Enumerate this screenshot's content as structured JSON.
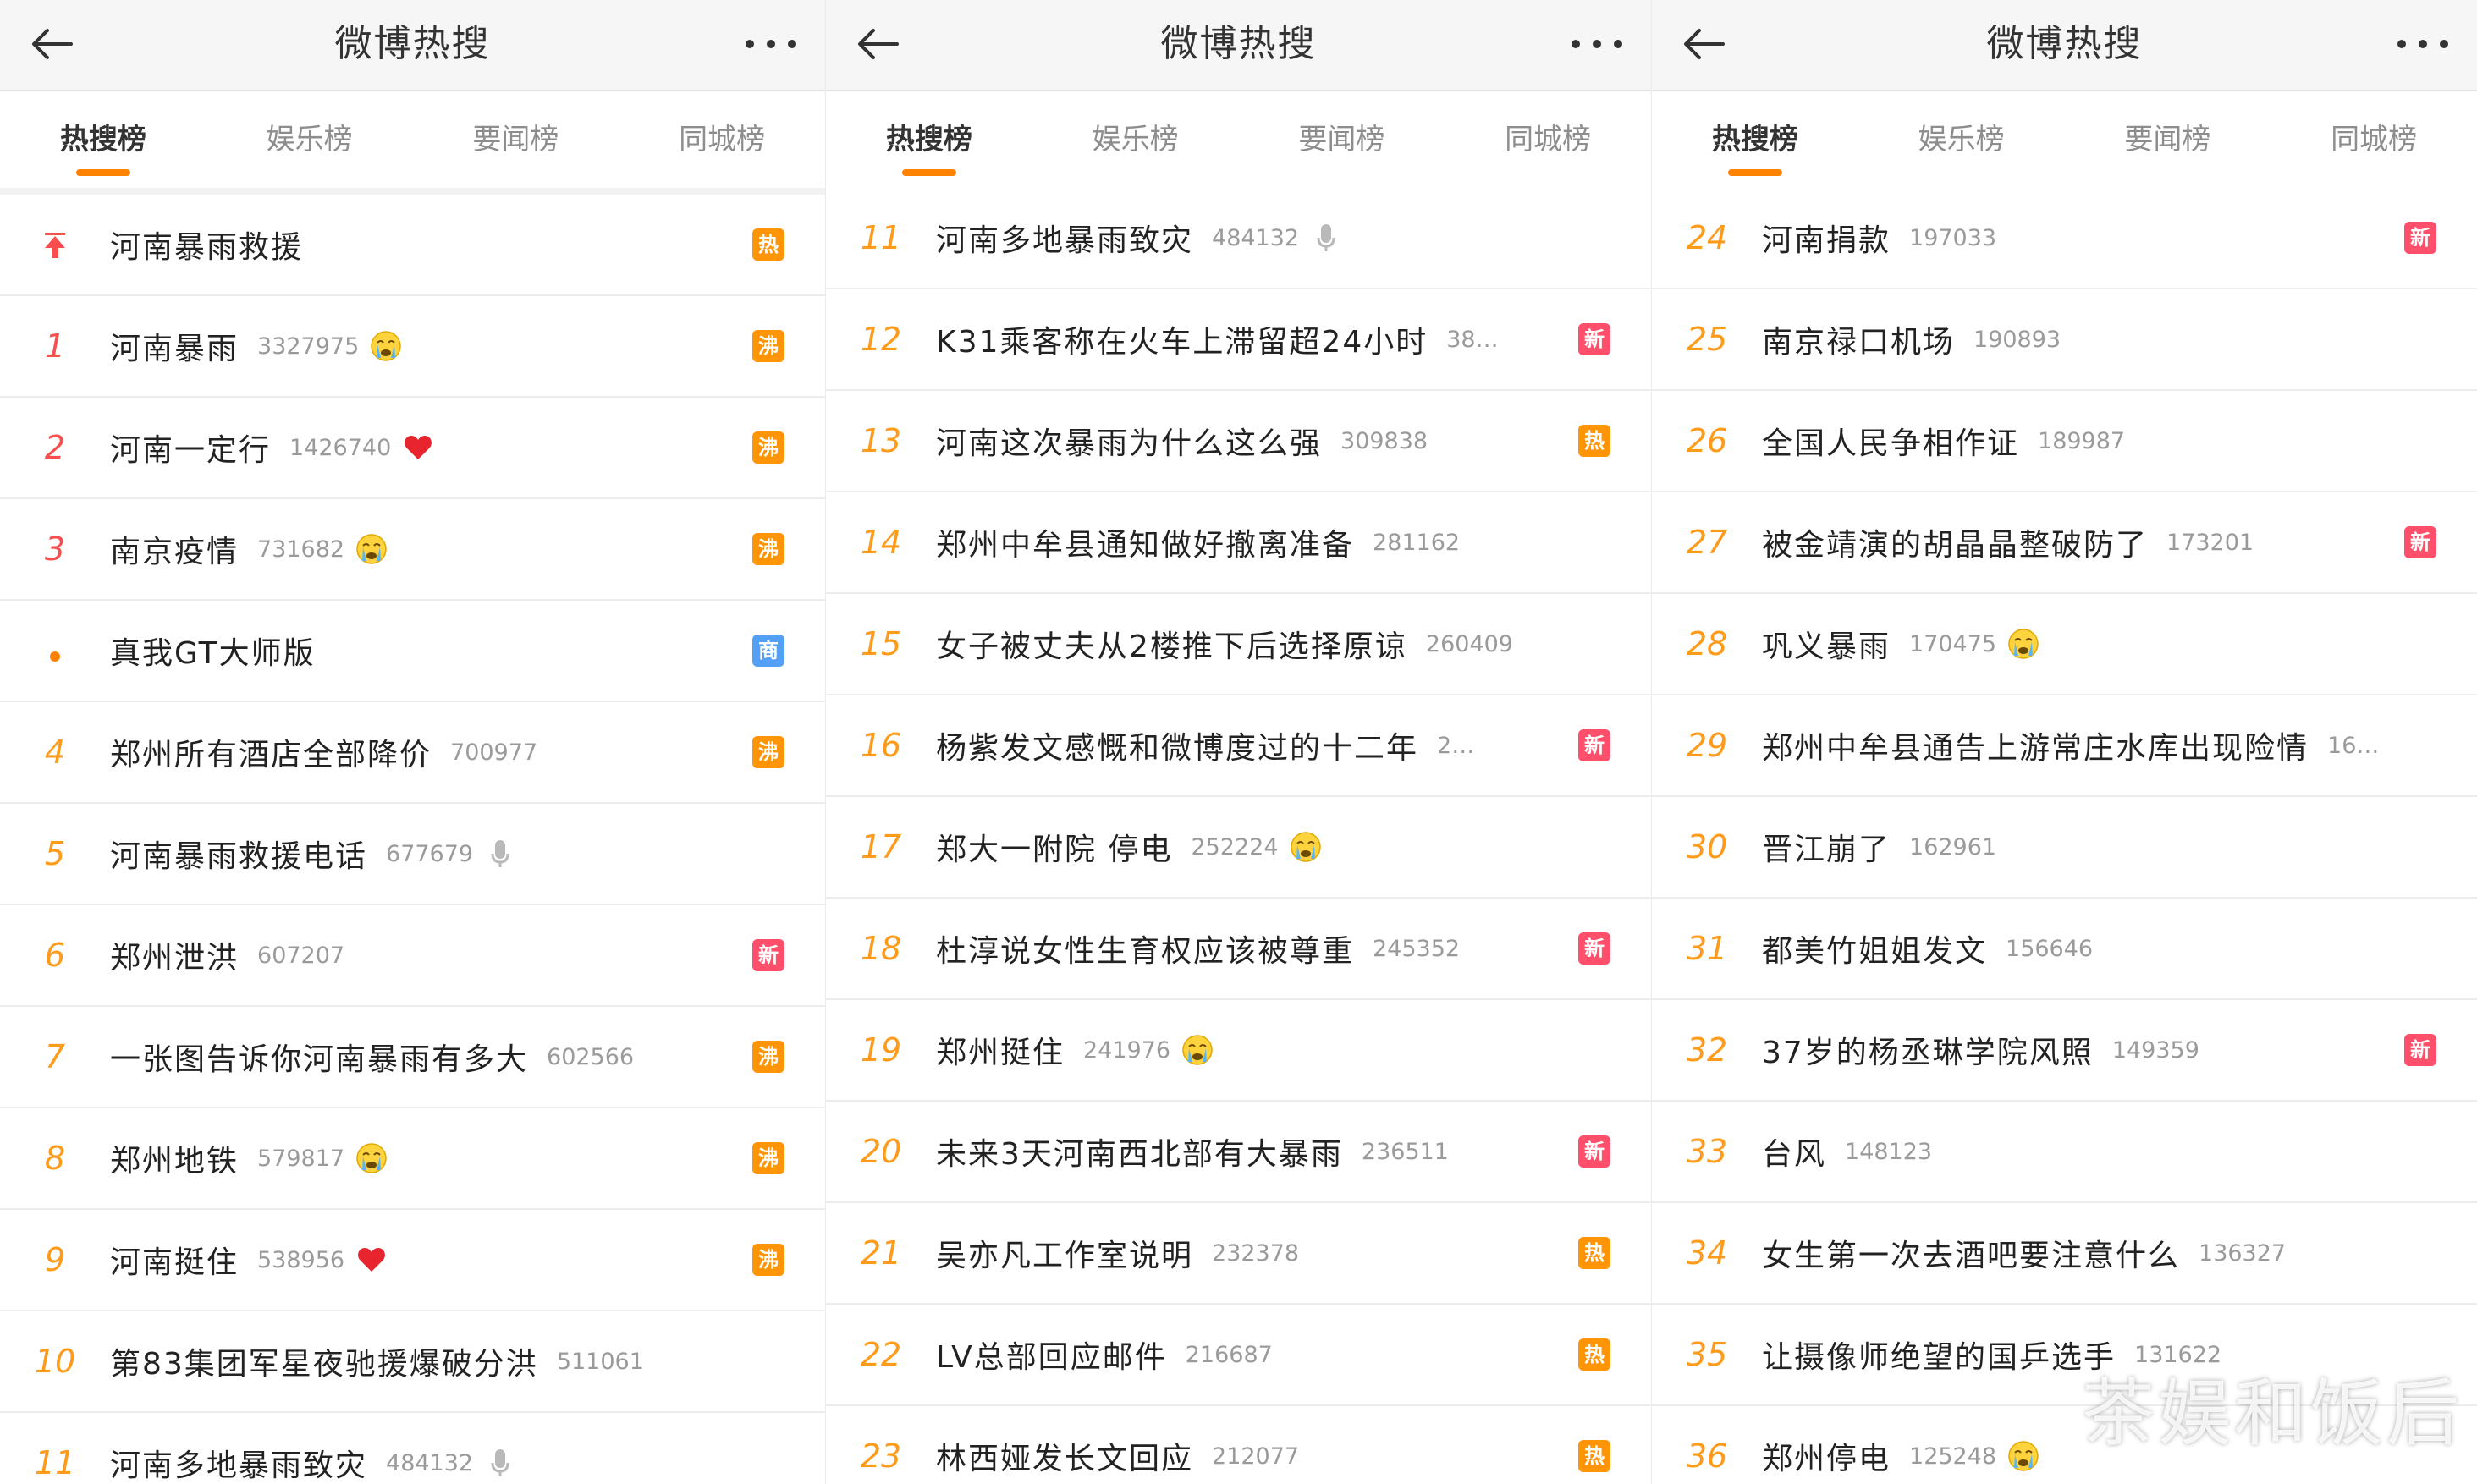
{
  "panels": [
    {
      "title": "微博热搜",
      "tabs": [
        "热搜榜",
        "娱乐榜",
        "要闻榜",
        "同城榜"
      ],
      "items": [
        {
          "rank": "",
          "kind": "pin",
          "name": "河南暴雨救援",
          "count": "",
          "emoji": "",
          "badge": "热"
        },
        {
          "rank": "1",
          "kind": "top",
          "name": "河南暴雨",
          "count": "3327975",
          "emoji": "cry",
          "badge": "沸"
        },
        {
          "rank": "2",
          "kind": "top",
          "name": "河南一定行",
          "count": "1426740",
          "emoji": "heart",
          "badge": "沸"
        },
        {
          "rank": "3",
          "kind": "top",
          "name": "南京疫情",
          "count": "731682",
          "emoji": "cry",
          "badge": "沸"
        },
        {
          "rank": "",
          "kind": "dot",
          "name": "真我GT大师版",
          "count": "",
          "emoji": "",
          "badge": "商"
        },
        {
          "rank": "4",
          "kind": "normal",
          "name": "郑州所有酒店全部降价",
          "count": "700977",
          "emoji": "",
          "badge": "沸"
        },
        {
          "rank": "5",
          "kind": "normal",
          "name": "河南暴雨救援电话",
          "count": "677679",
          "emoji": "mic",
          "badge": ""
        },
        {
          "rank": "6",
          "kind": "normal",
          "name": "郑州泄洪",
          "count": "607207",
          "emoji": "",
          "badge": "新"
        },
        {
          "rank": "7",
          "kind": "normal",
          "name": "一张图告诉你河南暴雨有多大",
          "count": "602566",
          "emoji": "",
          "badge": "沸"
        },
        {
          "rank": "8",
          "kind": "normal",
          "name": "郑州地铁",
          "count": "579817",
          "emoji": "cry",
          "badge": "沸"
        },
        {
          "rank": "9",
          "kind": "normal",
          "name": "河南挺住",
          "count": "538956",
          "emoji": "heart",
          "badge": "沸"
        },
        {
          "rank": "10",
          "kind": "normal",
          "name": "第83集团军星夜驰援爆破分洪",
          "count": "511061",
          "emoji": "",
          "badge": ""
        },
        {
          "rank": "11",
          "kind": "normal",
          "name": "河南多地暴雨致灾",
          "count": "484132",
          "emoji": "mic",
          "badge": ""
        }
      ]
    },
    {
      "title": "微博热搜",
      "tabs": [
        "热搜榜",
        "娱乐榜",
        "要闻榜",
        "同城榜"
      ],
      "items": [
        {
          "rank": "11",
          "kind": "normal",
          "name": "河南多地暴雨致灾",
          "count": "484132",
          "emoji": "mic",
          "badge": ""
        },
        {
          "rank": "12",
          "kind": "normal",
          "name": "K31乘客称在火车上滞留超24小时",
          "count": "38…",
          "emoji": "",
          "badge": "新"
        },
        {
          "rank": "13",
          "kind": "normal",
          "name": "河南这次暴雨为什么这么强",
          "count": "309838",
          "emoji": "",
          "badge": "热"
        },
        {
          "rank": "14",
          "kind": "normal",
          "name": "郑州中牟县通知做好撤离准备",
          "count": "281162",
          "emoji": "",
          "badge": ""
        },
        {
          "rank": "15",
          "kind": "normal",
          "name": "女子被丈夫从2楼推下后选择原谅",
          "count": "260409",
          "emoji": "",
          "badge": ""
        },
        {
          "rank": "16",
          "kind": "normal",
          "name": "杨紫发文感慨和微博度过的十二年",
          "count": "2…",
          "emoji": "",
          "badge": "新"
        },
        {
          "rank": "17",
          "kind": "normal",
          "name": "郑大一附院 停电",
          "count": "252224",
          "emoji": "cry",
          "badge": ""
        },
        {
          "rank": "18",
          "kind": "normal",
          "name": "杜淳说女性生育权应该被尊重",
          "count": "245352",
          "emoji": "",
          "badge": "新"
        },
        {
          "rank": "19",
          "kind": "normal",
          "name": "郑州挺住",
          "count": "241976",
          "emoji": "cry",
          "badge": ""
        },
        {
          "rank": "20",
          "kind": "normal",
          "name": "未来3天河南西北部有大暴雨",
          "count": "236511",
          "emoji": "",
          "badge": "新"
        },
        {
          "rank": "21",
          "kind": "normal",
          "name": "吴亦凡工作室说明",
          "count": "232378",
          "emoji": "",
          "badge": "热"
        },
        {
          "rank": "22",
          "kind": "normal",
          "name": "LV总部回应邮件",
          "count": "216687",
          "emoji": "",
          "badge": "热"
        },
        {
          "rank": "23",
          "kind": "normal",
          "name": "林西娅发长文回应",
          "count": "212077",
          "emoji": "",
          "badge": "热"
        }
      ]
    },
    {
      "title": "微博热搜",
      "tabs": [
        "热搜榜",
        "娱乐榜",
        "要闻榜",
        "同城榜"
      ],
      "items": [
        {
          "rank": "24",
          "kind": "normal",
          "name": "河南捐款",
          "count": "197033",
          "emoji": "",
          "badge": "新"
        },
        {
          "rank": "25",
          "kind": "normal",
          "name": "南京禄口机场",
          "count": "190893",
          "emoji": "",
          "badge": ""
        },
        {
          "rank": "26",
          "kind": "normal",
          "name": "全国人民争相作证",
          "count": "189987",
          "emoji": "",
          "badge": ""
        },
        {
          "rank": "27",
          "kind": "normal",
          "name": "被金靖演的胡晶晶整破防了",
          "count": "173201",
          "emoji": "",
          "badge": "新"
        },
        {
          "rank": "28",
          "kind": "normal",
          "name": "巩义暴雨",
          "count": "170475",
          "emoji": "cry",
          "badge": ""
        },
        {
          "rank": "29",
          "kind": "normal",
          "name": "郑州中牟县通告上游常庄水库出现险情",
          "count": "16…",
          "emoji": "",
          "badge": ""
        },
        {
          "rank": "30",
          "kind": "normal",
          "name": "晋江崩了",
          "count": "162961",
          "emoji": "",
          "badge": ""
        },
        {
          "rank": "31",
          "kind": "normal",
          "name": "都美竹姐姐发文",
          "count": "156646",
          "emoji": "",
          "badge": ""
        },
        {
          "rank": "32",
          "kind": "normal",
          "name": "37岁的杨丞琳学院风照",
          "count": "149359",
          "emoji": "",
          "badge": "新"
        },
        {
          "rank": "33",
          "kind": "normal",
          "name": "台风",
          "count": "148123",
          "emoji": "",
          "badge": ""
        },
        {
          "rank": "34",
          "kind": "normal",
          "name": "女生第一次去酒吧要注意什么",
          "count": "136327",
          "emoji": "",
          "badge": ""
        },
        {
          "rank": "35",
          "kind": "normal",
          "name": "让摄像师绝望的国乒选手",
          "count": "131622",
          "emoji": "",
          "badge": ""
        },
        {
          "rank": "36",
          "kind": "normal",
          "name": "郑州停电",
          "count": "125248",
          "emoji": "cry",
          "badge": ""
        }
      ]
    }
  ],
  "watermark": "茶娱和饭后",
  "colors": {
    "accent": "#ff8200",
    "rank_top": "#f84e4e",
    "rank_normal": "#ff9b1a",
    "badge_hot": "#ff9406",
    "badge_new": "#ff4f6b",
    "badge_ad": "#55a0f7"
  }
}
